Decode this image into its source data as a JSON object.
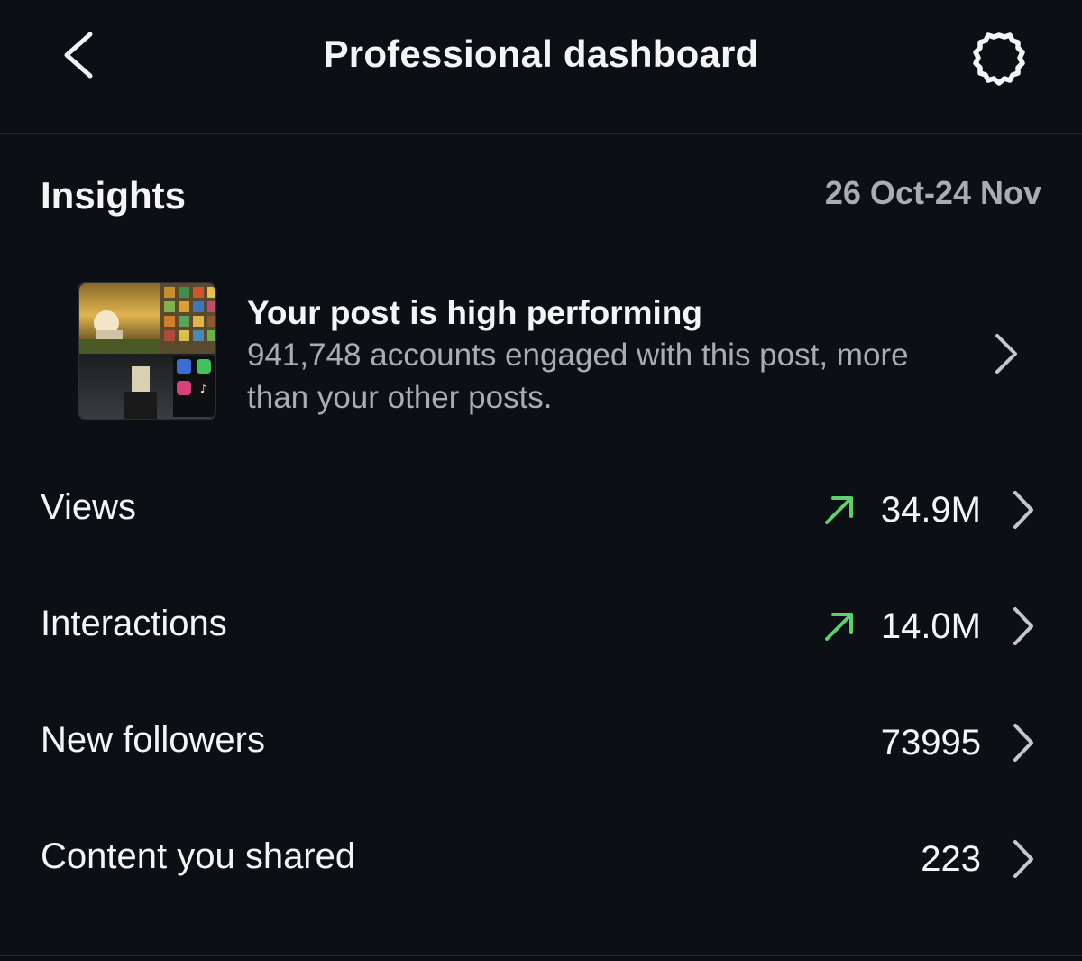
{
  "header": {
    "title": "Professional dashboard",
    "back_icon": "chevron-left-icon",
    "settings_icon": "gear-icon"
  },
  "insights": {
    "title": "Insights",
    "date_range": "26 Oct-24 Nov",
    "highlight": {
      "title": "Your post is high performing",
      "description": "941,748 accounts engaged with this post, more than your other posts."
    },
    "metrics": [
      {
        "label": "Views",
        "value": "34.9M",
        "trend": "up"
      },
      {
        "label": "Interactions",
        "value": "14.0M",
        "trend": "up"
      },
      {
        "label": "New followers",
        "value": "73995",
        "trend": "none"
      },
      {
        "label": "Content you shared",
        "value": "223",
        "trend": "none"
      }
    ]
  },
  "colors": {
    "background": "#0c1014",
    "text_primary": "#f5f5f5",
    "text_secondary": "#a8adb3",
    "trend_up": "#5cd16e"
  }
}
